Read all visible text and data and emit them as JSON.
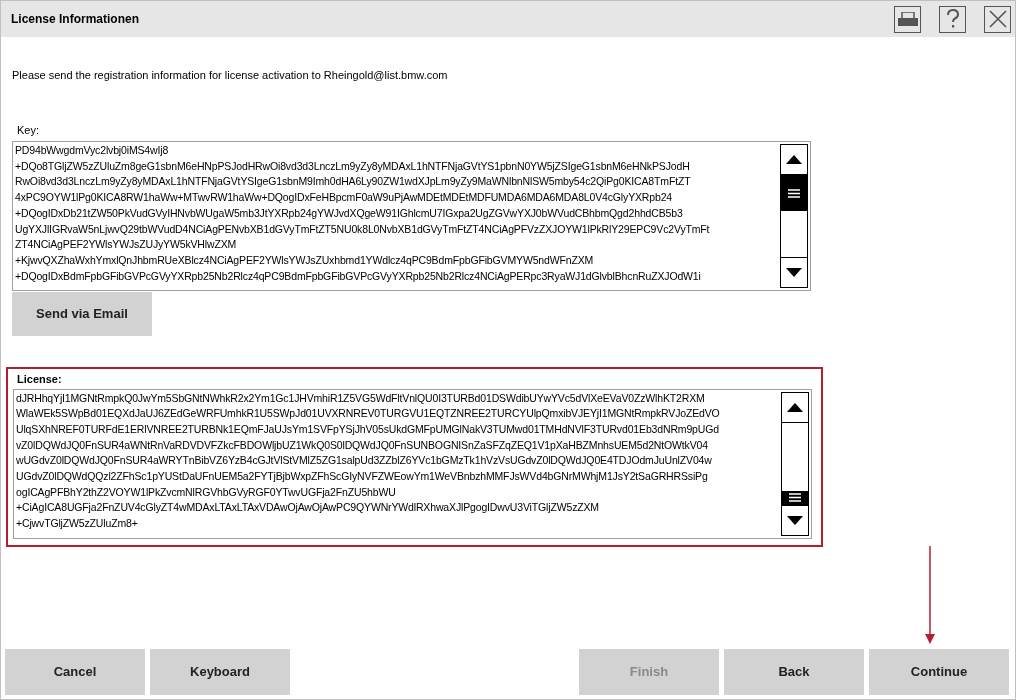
{
  "window": {
    "title": "License Informationen"
  },
  "message": "Please send the registration information for license activation to Rheingold@list.bmw.com",
  "key": {
    "label": "Key:",
    "lines": [
      "PD94bWwgdmVyc2lvbj0iMS4wIj8",
      "+DQo8TGljZW5zZUluZm8geG1sbnM6eHNpPSJodHRwOi8vd3d3LnczLm9yZy8yMDAxL1hNTFNjaGVtYS1pbnN0YW5jZSIgeG1sbnM6eHNkPSJodH",
      "RwOi8vd3d3LnczLm9yZy8yMDAxL1hNTFNjaGVtYSIgeG1sbnM9Imh0dHA6Ly90ZW1wdXJpLm9yZy9MaWNlbnNlSW5mby54c2QiPg0KICA8TmFtZT",
      "4xPC9OYW1lPg0KICA8RW1haWw+MTwvRW1haWw+DQogIDxFeHBpcmF0aW9uPjAwMDEtMDEtMDFUMDA6MDA6MDA8L0V4cGlyYXRpb24",
      "+DQogIDxDb21tZW50PkVudGVyIHNvbWUgaW5mb3JtYXRpb24gYWJvdXQgeW91IGhlcmU7IGxpa2UgZGVwYXJ0bWVudCBhbmQgd2hhdCB5b3",
      "UgYXJlIGRvaW5nLjwvQ29tbWVudD4NCiAgPENvbXB1dGVyTmFtZT5NU0k8L0NvbXB1dGVyTmFtZT4NCiAgPFVzZXJOYW1lPkRlY29EPC9Vc2VyTmFt",
      "ZT4NCiAgPEF2YWlsYWJsZUJyYW5kVHlwZXM",
      "+KjwvQXZhaWxhYmxlQnJhbmRUeXBlcz4NCiAgPEF2YWlsYWJsZUxhbmd1YWdlcz4qPC9BdmFpbGFibGVMYW5ndWFnZXM",
      "+DQogIDxBdmFpbGFibGVPcGVyYXRpb25Nb2Rlcz4qPC9BdmFpbGFibGVPcGVyYXRpb25Nb2Rlcz4NCiAgPERpc3RyaWJ1dGlvblBhcnRuZXJOdW1i"
    ]
  },
  "send_button": "Send via Email",
  "license": {
    "label": "License:",
    "highlighted": true,
    "lines": [
      "dJRHhqYjI1MGNtRmpkQ0JwYm5SbGNtNWhkR2x2Ym1Gc1JHVmhiR1Z5VG5WdFltVnlQU0I3TURBd01DSWdibUYwYVc5dVlXeEVaV0ZzWlhKT2RXM",
      "WlaWEk5SWpBd01EQXdJaUJ6ZEdGeWRFUmhkR1U5SWpJd01UVXRNREV0TURGVU1EQTZNREE2TURCYUlpQmxibVJEYjI1MGNtRmpkRVJoZEdVO",
      "UlqSXhNREF0TURFdE1ERlVNREE2TURBNk1EQmFJaUJsYm1SVFpYSjJhV05sUkdGMFpUMGlNakV3TUMwd01TMHdNVlF3TURvd01Eb3dNRm9pUGd",
      "vZ0lDQWdJQ0FnSUR4aWNtRnVaRDVDVFZkcFBDOWljbUZ1WkQ0S0lDQWdJQ0FnSUNBOGNISnZaSFZqZEQ1V1pXaHBZMnhsUEM5d2NtOWtkV04",
      "wUGdvZ0lDQWdJQ0FnSUR4aWRYTnBibVZ6YzB4cGJtVlStVMlZ5ZG1salpUd3ZZblZ6YVc1bGMzTk1hVzVsUGdvZ0lDQWdJQ0E4TDJOdmJuUnlZV04w",
      "UGdvZ0lDQWdQQzl2ZFhSc1pYUStDaUFnUEM5a2FYTjBjbWxpZFhScGIyNVFZWEowYm1WeVBnbzhMMFJsWVd4bGNrMWhjM1JsY2tSaGRHRSsiPg",
      "ogICAgPFBhY2thZ2VOYW1lPkZvcmNlRGVhbGVyRGF0YTwvUGFja2FnZU5hbWU",
      "+CiAgICA8UGFja2FnZUV4cGlyZT4wMDAxLTAxLTAxVDAwOjAwOjAwPC9QYWNrYWdlRXhwaXJlPgogIDwvU3ViTGljZW5zZXM",
      "+CjwvTGljZW5zZUluZm8+"
    ]
  },
  "left_buttons": [
    {
      "label": "Cancel",
      "disabled": false
    },
    {
      "label": "Keyboard",
      "disabled": false
    }
  ],
  "right_buttons": [
    {
      "label": "Finish",
      "disabled": true
    },
    {
      "label": "Back",
      "disabled": false
    },
    {
      "label": "Continue",
      "disabled": false
    }
  ]
}
